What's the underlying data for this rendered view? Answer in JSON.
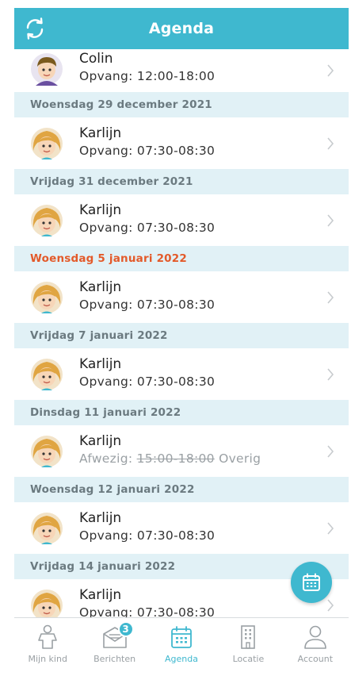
{
  "header": {
    "title": "Agenda"
  },
  "list": {
    "first_row": {
      "name": "Colin",
      "detail": "Opvang: 12:00-18:00"
    },
    "sections": [
      {
        "date": "Woensdag 29 december 2021",
        "row": {
          "name": "Karlijn",
          "detail": "Opvang: 07:30-08:30"
        }
      },
      {
        "date": "Vrijdag 31 december 2021",
        "row": {
          "name": "Karlijn",
          "detail": "Opvang: 07:30-08:30"
        }
      },
      {
        "date": "Woensdag 5 januari 2022",
        "row": {
          "name": "Karlijn",
          "detail": "Opvang: 07:30-08:30"
        }
      },
      {
        "date": "Vrijdag 7 januari 2022",
        "row": {
          "name": "Karlijn",
          "detail": "Opvang: 07:30-08:30"
        }
      },
      {
        "date": "Dinsdag 11 januari 2022",
        "row": {
          "name": "Karlijn",
          "absent_prefix": "Afwezig:",
          "absent_time": "15:00-18:00",
          "absent_reason": "Overig"
        }
      },
      {
        "date": "Woensdag 12 januari 2022",
        "row": {
          "name": "Karlijn",
          "detail": "Opvang: 07:30-08:30"
        }
      },
      {
        "date": "Vrijdag 14 januari 2022",
        "row": {
          "name": "Karlijn",
          "detail": "Opvang: 07:30-08:30"
        }
      }
    ]
  },
  "tabs": [
    {
      "label": "Mijn kind",
      "icon": "child-icon"
    },
    {
      "label": "Berichten",
      "icon": "messages-icon",
      "badge": "3"
    },
    {
      "label": "Agenda",
      "icon": "calendar-icon",
      "active": true
    },
    {
      "label": "Locatie",
      "icon": "building-icon"
    },
    {
      "label": "Account",
      "icon": "person-icon"
    }
  ],
  "colors": {
    "accent": "#3fb8cf",
    "section_bg": "#e1f1f6",
    "today_text": "#e35a2a",
    "muted": "#9aa0a4"
  }
}
